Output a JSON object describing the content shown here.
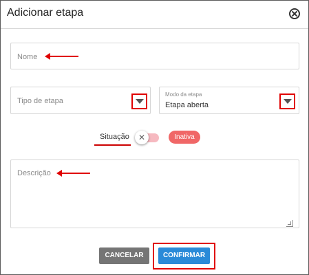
{
  "dialog": {
    "title": "Adicionar etapa",
    "close_icon": "close-circle-icon"
  },
  "form": {
    "name_placeholder": "Nome",
    "tipo_placeholder": "Tipo de etapa",
    "modo_label": "Modo da etapa",
    "modo_value": "Etapa aberta",
    "situacao_label": "Situação",
    "toggle_state": false,
    "toggle_icon": "x-icon",
    "status_badge": "Inativa",
    "descricao_placeholder": "Descrição"
  },
  "actions": {
    "cancel_label": "CANCELAR",
    "confirm_label": "CONFIRMAR"
  },
  "colors": {
    "confirm": "#2a8ad8",
    "cancel": "#757575",
    "badge": "#f06767",
    "annotation": "#e00000"
  }
}
